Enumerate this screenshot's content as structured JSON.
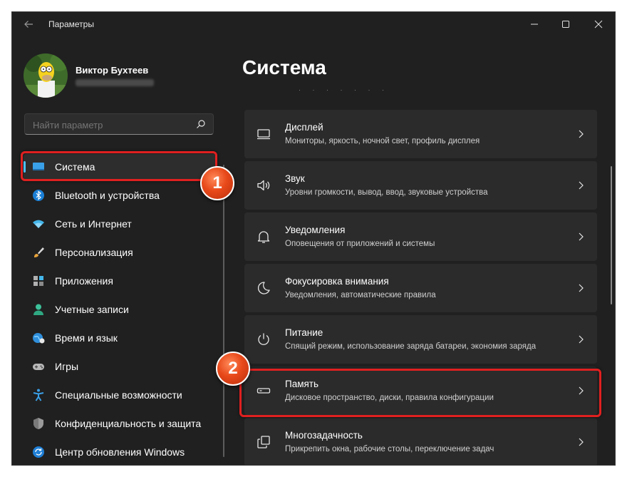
{
  "window": {
    "title": "Параметры",
    "controls": [
      "minimize-icon",
      "maximize-icon",
      "close-icon"
    ]
  },
  "profile": {
    "name": "Виктор Бухтеев"
  },
  "search": {
    "placeholder": "Найти параметр"
  },
  "sidebar": {
    "items": [
      {
        "label": "Система",
        "icon": "system-monitor-icon",
        "active": true
      },
      {
        "label": "Bluetooth и устройства",
        "icon": "bluetooth-icon"
      },
      {
        "label": "Сеть и Интернет",
        "icon": "wifi-icon"
      },
      {
        "label": "Персонализация",
        "icon": "brush-icon"
      },
      {
        "label": "Приложения",
        "icon": "apps-icon"
      },
      {
        "label": "Учетные записи",
        "icon": "account-icon"
      },
      {
        "label": "Время и язык",
        "icon": "globe-clock-icon"
      },
      {
        "label": "Игры",
        "icon": "gamepad-icon"
      },
      {
        "label": "Специальные возможности",
        "icon": "accessibility-icon"
      },
      {
        "label": "Конфиденциальность и защита",
        "icon": "shield-icon"
      },
      {
        "label": "Центр обновления Windows",
        "icon": "update-icon"
      }
    ]
  },
  "main": {
    "title": "Система",
    "cards": [
      {
        "title": "Дисплей",
        "subtitle": "Мониторы, яркость, ночной свет, профиль дисплея",
        "icon": "display-icon"
      },
      {
        "title": "Звук",
        "subtitle": "Уровни громкости, вывод, ввод, звуковые устройства",
        "icon": "speaker-icon"
      },
      {
        "title": "Уведомления",
        "subtitle": "Оповещения от приложений и системы",
        "icon": "bell-icon"
      },
      {
        "title": "Фокусировка внимания",
        "subtitle": "Уведомления, автоматические правила",
        "icon": "moon-icon"
      },
      {
        "title": "Питание",
        "subtitle": "Спящий режим, использование заряда батареи, экономия заряда",
        "icon": "power-icon"
      },
      {
        "title": "Память",
        "subtitle": "Дисковое пространство, диски, правила конфигурации",
        "icon": "storage-icon"
      },
      {
        "title": "Многозадачность",
        "subtitle": "Прикрепить окна, рабочие столы, переключение задач",
        "icon": "multitasking-icon"
      }
    ]
  },
  "annotations": {
    "step1": "1",
    "step2": "2"
  },
  "colors": {
    "accent": "#4cc2ff",
    "highlight": "#e02020",
    "badge": "#e8491a",
    "window_bg": "#202020",
    "card_bg": "#2b2b2b"
  }
}
